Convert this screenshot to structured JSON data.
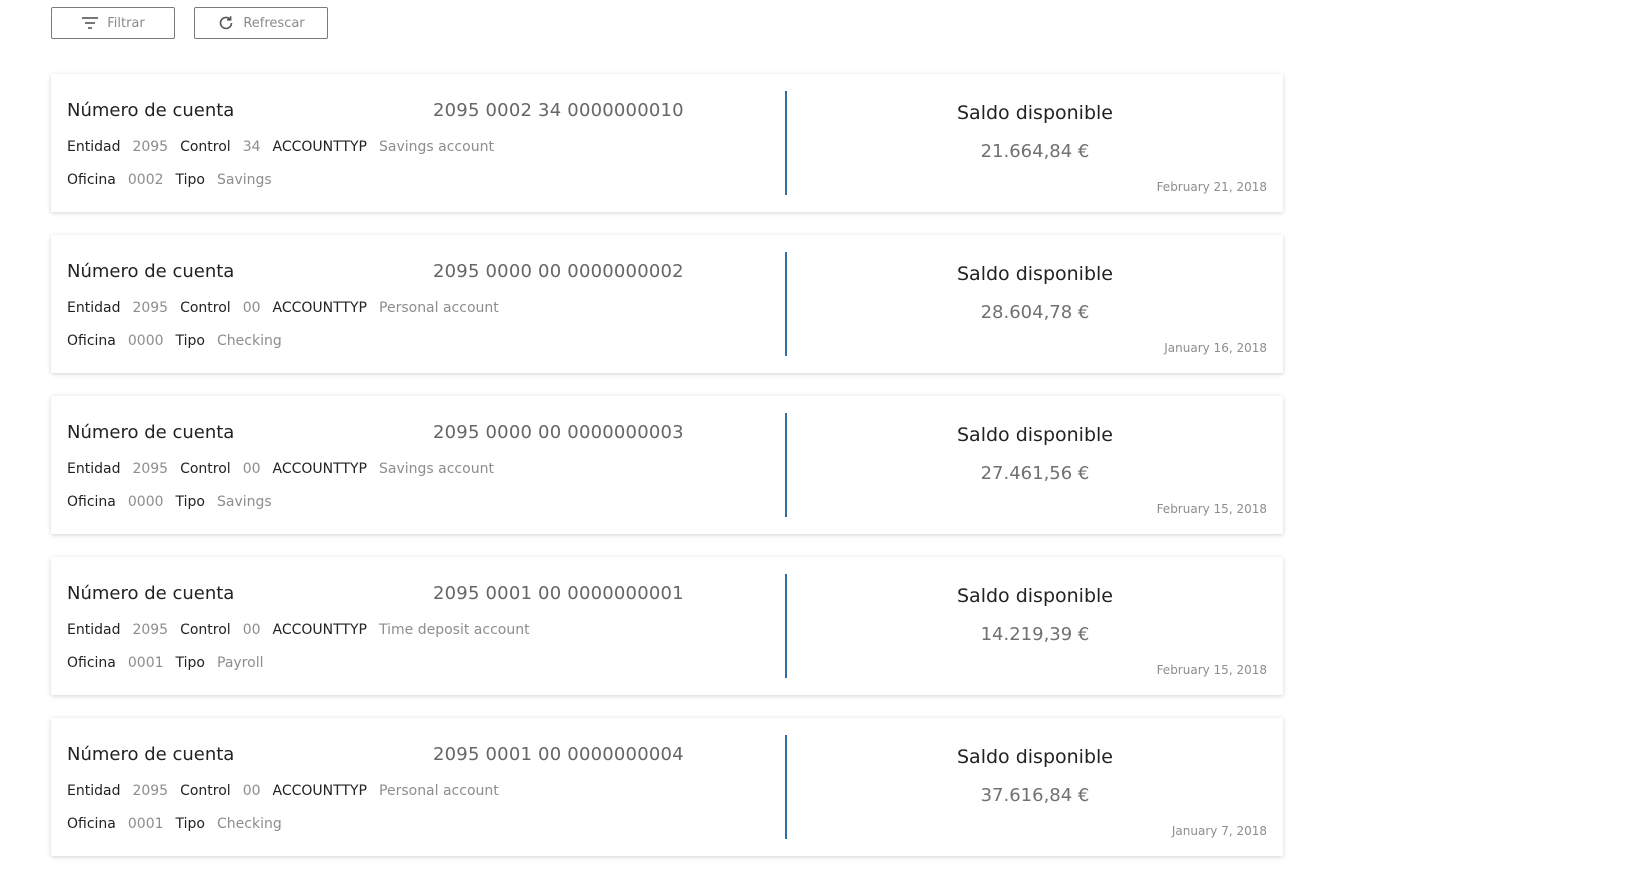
{
  "toolbar": {
    "filter_label": "Filtrar",
    "filter_icon": "filter-lines-icon",
    "refresh_label": "Refrescar",
    "refresh_icon": "refresh-icon"
  },
  "labels": {
    "account_number": "Número de cuenta",
    "entidad": "Entidad",
    "control": "Control",
    "accounttyp": "ACCOUNTTYP",
    "oficina": "Oficina",
    "tipo": "Tipo",
    "saldo": "Saldo disponible"
  },
  "colors": {
    "divider": "#2f6fa6"
  },
  "accounts": [
    {
      "number": "2095 0002 34 0000000010",
      "entidad": "2095",
      "control": "34",
      "accounttyp": "Savings account",
      "oficina": "0002",
      "tipo": "Savings",
      "saldo": "21.664,84 €",
      "date": "February 21, 2018"
    },
    {
      "number": "2095 0000 00 0000000002",
      "entidad": "2095",
      "control": "00",
      "accounttyp": "Personal account",
      "oficina": "0000",
      "tipo": "Checking",
      "saldo": "28.604,78 €",
      "date": "January 16, 2018"
    },
    {
      "number": "2095 0000 00 0000000003",
      "entidad": "2095",
      "control": "00",
      "accounttyp": "Savings account",
      "oficina": "0000",
      "tipo": "Savings",
      "saldo": "27.461,56 €",
      "date": "February 15, 2018"
    },
    {
      "number": "2095 0001 00 0000000001",
      "entidad": "2095",
      "control": "00",
      "accounttyp": "Time deposit account",
      "oficina": "0001",
      "tipo": "Payroll",
      "saldo": "14.219,39 €",
      "date": "February 15, 2018"
    },
    {
      "number": "2095 0001 00 0000000004",
      "entidad": "2095",
      "control": "00",
      "accounttyp": "Personal account",
      "oficina": "0001",
      "tipo": "Checking",
      "saldo": "37.616,84 €",
      "date": "January 7, 2018"
    }
  ]
}
